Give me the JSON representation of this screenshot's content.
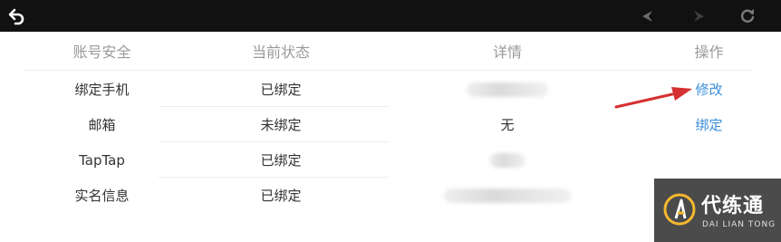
{
  "icons": {
    "back": "back-arrow-icon",
    "prev": "nav-prev-icon",
    "next": "nav-next-icon",
    "refresh": "refresh-icon"
  },
  "table": {
    "headers": {
      "account": "账号安全",
      "status": "当前状态",
      "detail": "详情",
      "action": "操作"
    },
    "rows": [
      {
        "account": "绑定手机",
        "status": "已绑定",
        "detail": "",
        "detail_blurred": true,
        "action": "修改"
      },
      {
        "account": "邮箱",
        "status": "未绑定",
        "detail": "无",
        "detail_blurred": false,
        "action": "绑定"
      },
      {
        "account": "TapTap",
        "status": "已绑定",
        "detail": "",
        "detail_blurred": true,
        "action": ""
      },
      {
        "account": "实名信息",
        "status": "已绑定",
        "detail": "",
        "detail_blurred": true,
        "action": ""
      }
    ]
  },
  "annotation": {
    "arrow_color": "#d63030",
    "target": "修改"
  },
  "colors": {
    "topbar": "#111111",
    "link": "#3c8fd9",
    "header_text": "#9a9a9a",
    "watermark_bg": "#4b4b4b",
    "watermark_accent": "#f5b82e"
  },
  "watermark": {
    "title": "代练通",
    "subtitle": "DAI LIAN TONG"
  }
}
